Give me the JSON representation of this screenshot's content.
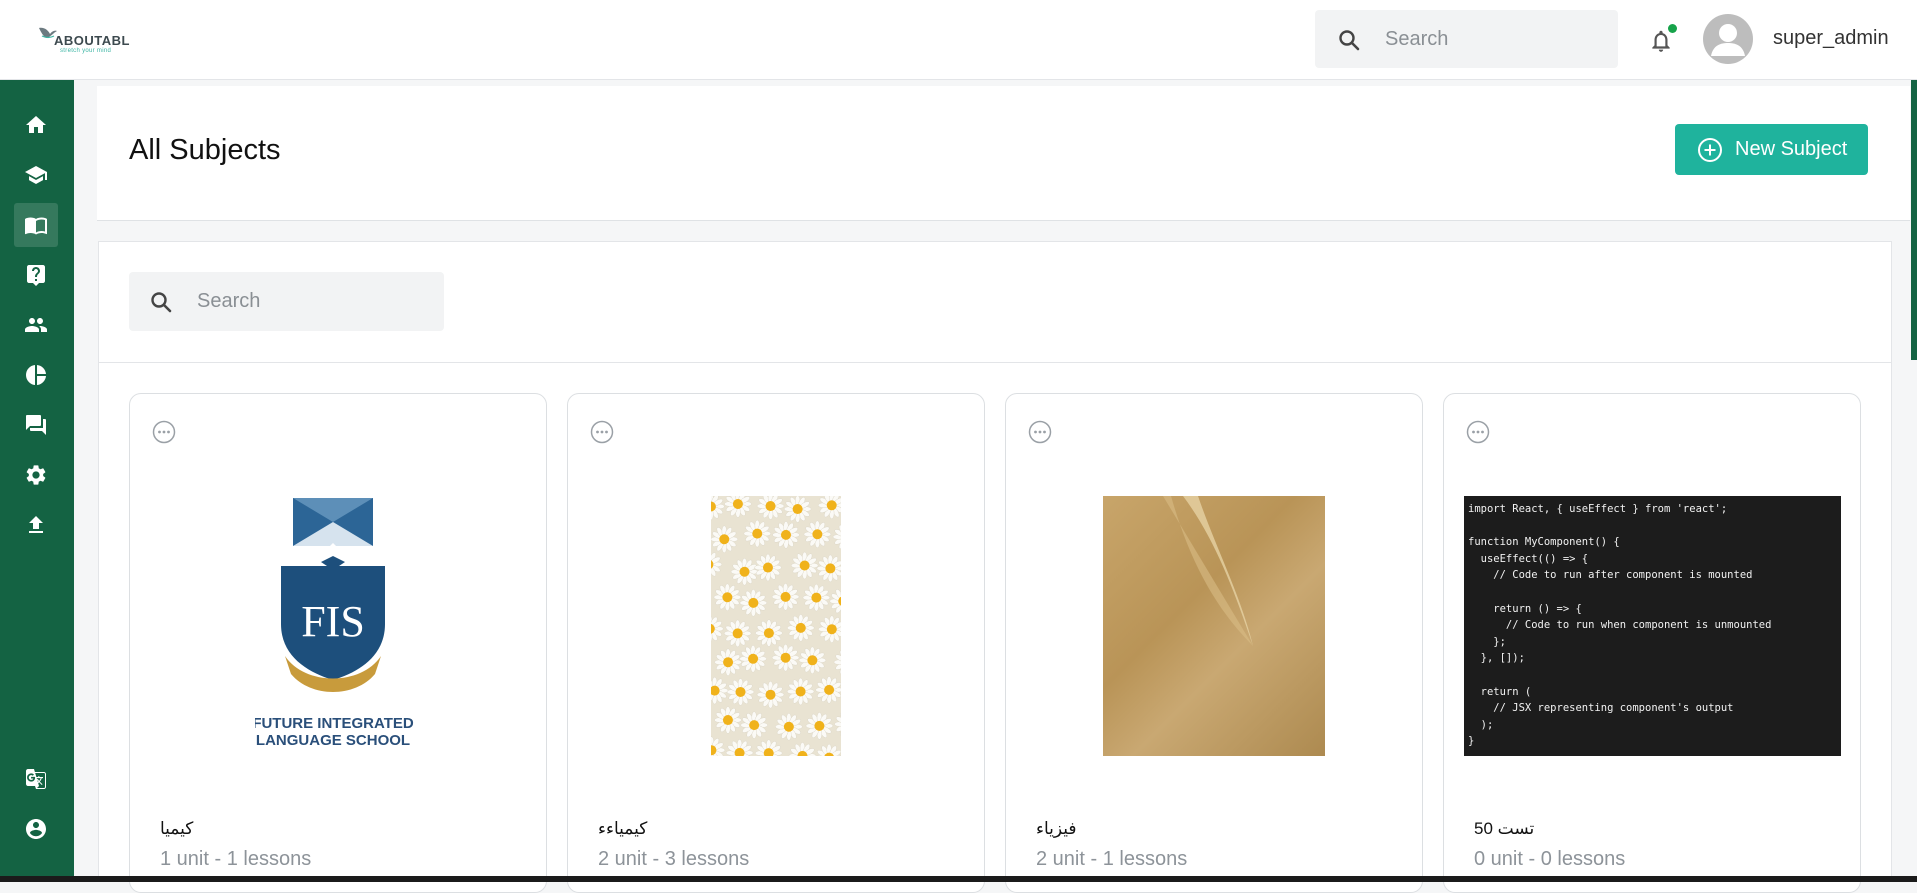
{
  "header": {
    "logo_text": "ABOUTABL",
    "logo_tagline": "stretch your mind",
    "search_placeholder": "Search",
    "username": "super_admin"
  },
  "sidebar": {
    "items": [
      {
        "name": "home",
        "icon": "home-icon",
        "active": false
      },
      {
        "name": "school",
        "icon": "graduation-cap-icon",
        "active": false
      },
      {
        "name": "subjects",
        "icon": "book-icon",
        "active": true
      },
      {
        "name": "questions",
        "icon": "help-icon",
        "active": false
      },
      {
        "name": "users",
        "icon": "people-icon",
        "active": false
      },
      {
        "name": "reports",
        "icon": "pie-chart-icon",
        "active": false
      },
      {
        "name": "messages",
        "icon": "chat-icon",
        "active": false
      },
      {
        "name": "settings",
        "icon": "gear-icon",
        "active": false
      },
      {
        "name": "upload",
        "icon": "upload-icon",
        "active": false
      },
      {
        "name": "translate",
        "icon": "translate-icon",
        "active": false
      },
      {
        "name": "account",
        "icon": "account-icon",
        "active": false
      }
    ]
  },
  "page": {
    "title": "All Subjects",
    "new_button_label": "New Subject",
    "filter_placeholder": "Search"
  },
  "subjects": [
    {
      "name": "كيميا",
      "meta": "1 unit - 1 lessons",
      "image": "fis-logo"
    },
    {
      "name": "كيمياءء",
      "meta": "2 unit - 3 lessons",
      "image": "daisies"
    },
    {
      "name": "فيزياء",
      "meta": "2 unit - 1 lessons",
      "image": "sand"
    },
    {
      "name": "تست 50",
      "meta": "0 unit - 0 lessons",
      "image": "code-snippet"
    }
  ],
  "fis_logo": {
    "letters": "FIS",
    "line1": "FUTURE INTEGRATED",
    "line2": "LANGUAGE SCHOOL"
  },
  "code_snippet": [
    "import React, { useEffect } from 'react';",
    "",
    "function MyComponent() {",
    "  useEffect(() => {",
    "    // Code to run after component is mounted",
    "",
    "    return () => {",
    "      // Code to run when component is unmounted",
    "    };",
    "  }, []);",
    "",
    "  return (",
    "    // JSX representing component's output",
    "  );",
    "}"
  ],
  "colors": {
    "sidebar": "#146343",
    "accent": "#1fb39d",
    "notification_dot": "#17a34a"
  }
}
